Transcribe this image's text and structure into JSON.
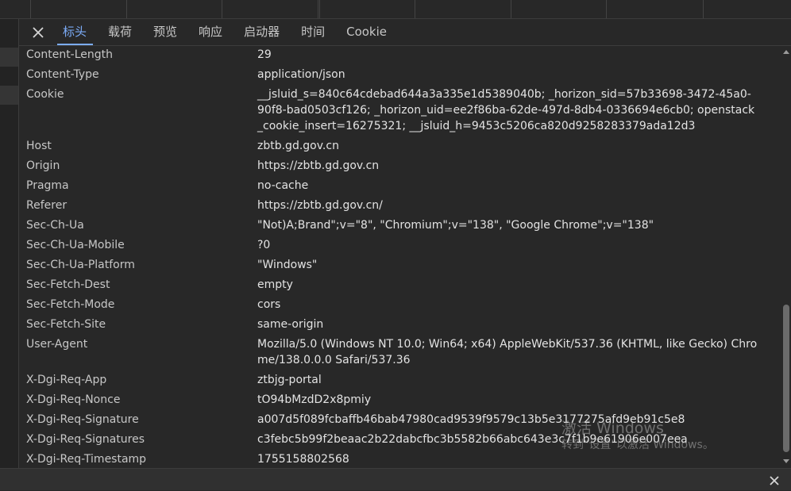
{
  "tabs": [
    {
      "label": "标头",
      "active": true
    },
    {
      "label": "载荷",
      "active": false
    },
    {
      "label": "预览",
      "active": false
    },
    {
      "label": "响应",
      "active": false
    },
    {
      "label": "启动器",
      "active": false
    },
    {
      "label": "时间",
      "active": false
    },
    {
      "label": "Cookie",
      "active": false
    }
  ],
  "headers": [
    {
      "name": "Content-Length",
      "value": "29"
    },
    {
      "name": "Content-Type",
      "value": "application/json"
    },
    {
      "name": "Cookie",
      "value": "__jsluid_s=840c64cdebad644a3a335e1d5389040b; _horizon_sid=57b33698-3472-45a0-90f8-bad0503cf126; _horizon_uid=ee2f86ba-62de-497d-8db4-0336694e6cb0; openstack_cookie_insert=16275321; __jsluid_h=9453c5206ca820d9258283379ada12d3"
    },
    {
      "name": "Host",
      "value": "zbtb.gd.gov.cn"
    },
    {
      "name": "Origin",
      "value": "https://zbtb.gd.gov.cn"
    },
    {
      "name": "Pragma",
      "value": "no-cache"
    },
    {
      "name": "Referer",
      "value": "https://zbtb.gd.gov.cn/"
    },
    {
      "name": "Sec-Ch-Ua",
      "value": "\"Not)A;Brand\";v=\"8\", \"Chromium\";v=\"138\", \"Google Chrome\";v=\"138\""
    },
    {
      "name": "Sec-Ch-Ua-Mobile",
      "value": "?0"
    },
    {
      "name": "Sec-Ch-Ua-Platform",
      "value": "\"Windows\""
    },
    {
      "name": "Sec-Fetch-Dest",
      "value": "empty"
    },
    {
      "name": "Sec-Fetch-Mode",
      "value": "cors"
    },
    {
      "name": "Sec-Fetch-Site",
      "value": "same-origin"
    },
    {
      "name": "User-Agent",
      "value": "Mozilla/5.0 (Windows NT 10.0; Win64; x64) AppleWebKit/537.36 (KHTML, like Gecko) Chrome/138.0.0.0 Safari/537.36"
    },
    {
      "name": "X-Dgi-Req-App",
      "value": "ztbjg-portal"
    },
    {
      "name": "X-Dgi-Req-Nonce",
      "value": "tO94bMzdD2x8pmiy"
    },
    {
      "name": "X-Dgi-Req-Signature",
      "value": "a007d5f089fcbaffb46bab47980cad9539f9579c13b5e3177275afd9eb91c5e8"
    },
    {
      "name": "X-Dgi-Req-Signatures",
      "value": "c3febc5b99f2beaac2b22dabcfbc3b5582b66abc643e3c7f1b9e61906e007eea"
    },
    {
      "name": "X-Dgi-Req-Timestamp",
      "value": "1755158802568"
    }
  ],
  "watermark": {
    "title": "激活 Windows",
    "subtitle": "转到\"设置\"以激活 Windows。"
  },
  "colors": {
    "accent": "#7cacf8",
    "background": "#282828"
  }
}
